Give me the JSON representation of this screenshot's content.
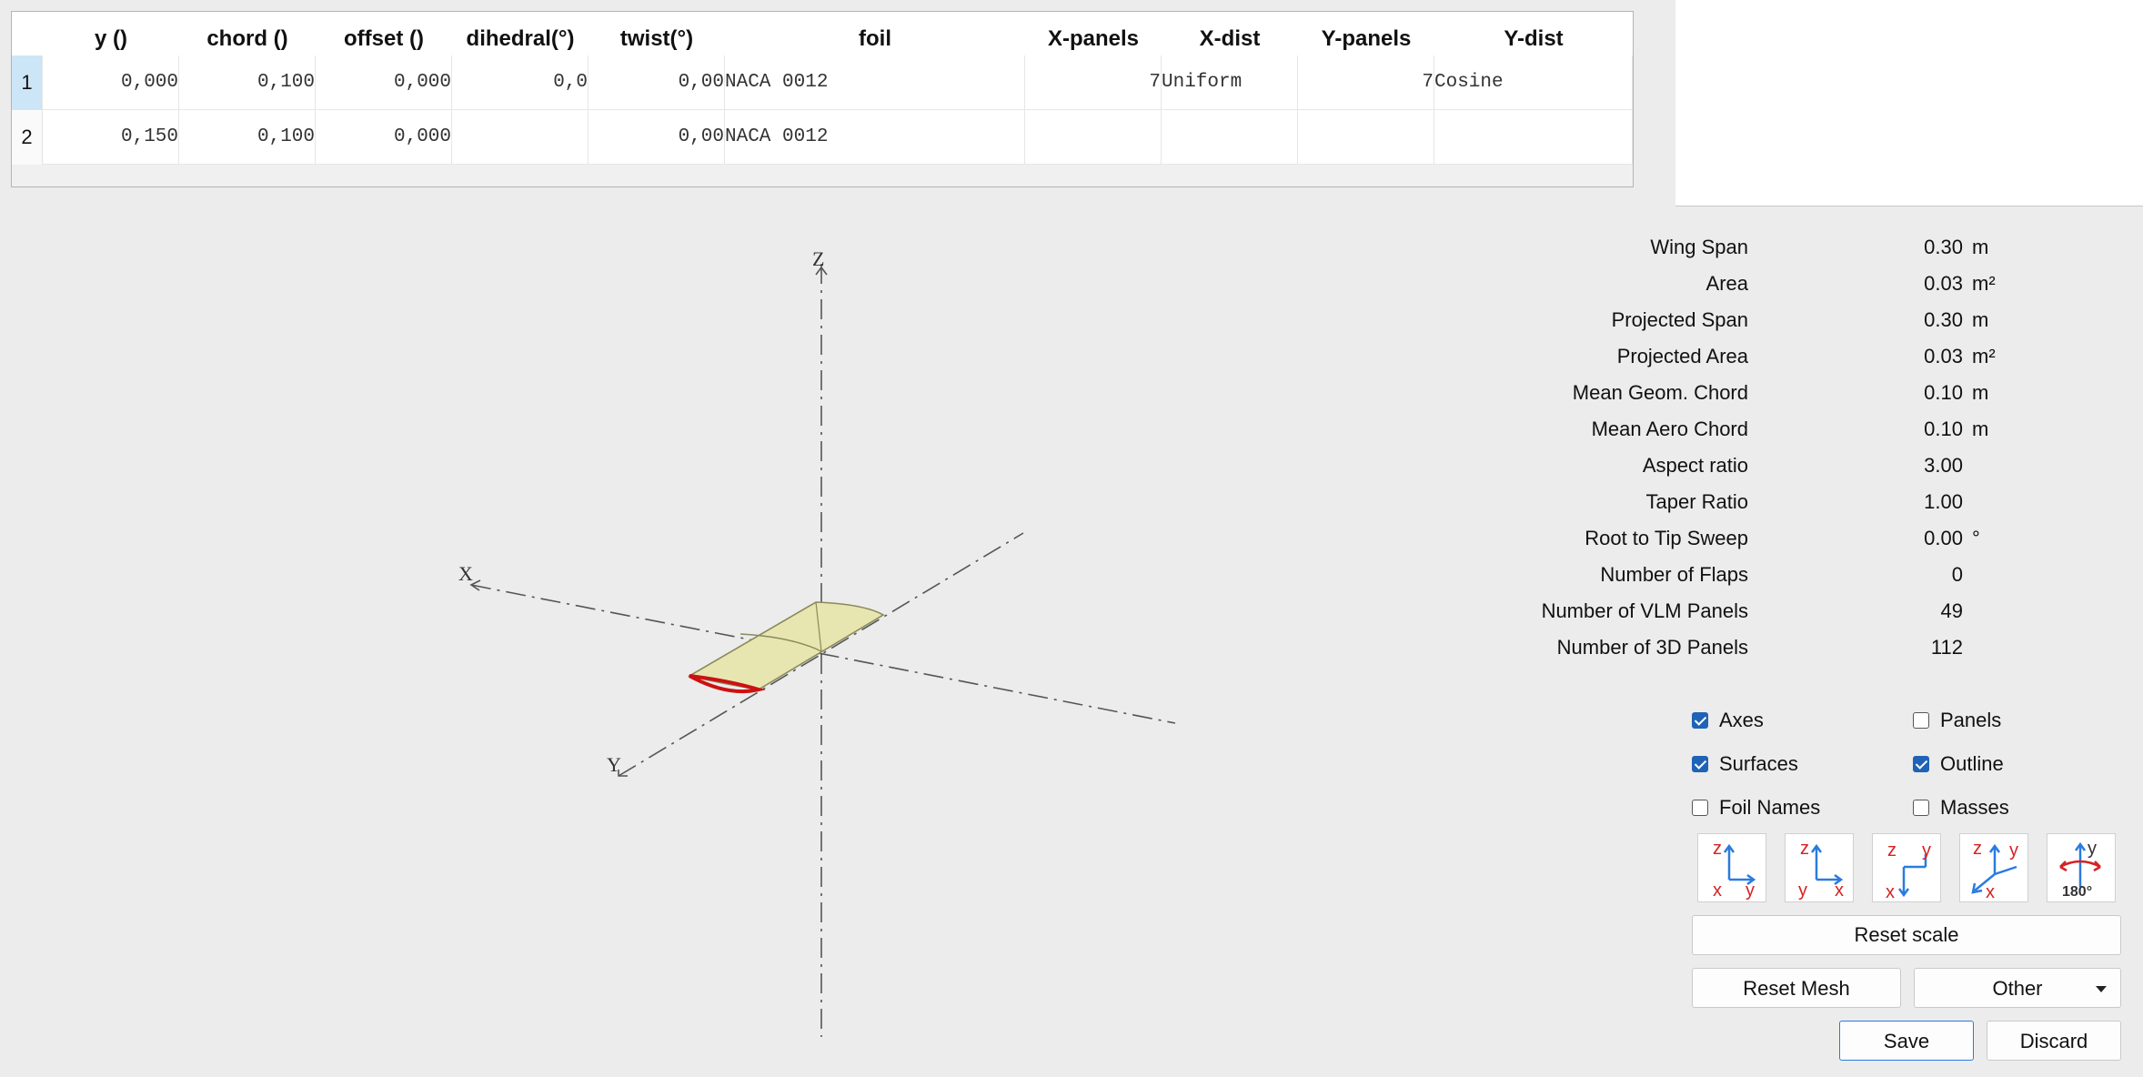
{
  "table": {
    "columns": [
      "y ()",
      "chord ()",
      "offset ()",
      "dihedral(°)",
      "twist(°)",
      "foil",
      "X-panels",
      "X-dist",
      "Y-panels",
      "Y-dist"
    ],
    "rows": [
      {
        "num": "1",
        "y": "0,000",
        "chord": "0,100",
        "offset": "0,000",
        "dihedral": "0,0",
        "twist": "0,00",
        "foil": "NACA 0012",
        "x_panels": "7",
        "x_dist": "Uniform",
        "y_panels": "7",
        "y_dist": "Cosine"
      },
      {
        "num": "2",
        "y": "0,150",
        "chord": "0,100",
        "offset": "0,000",
        "dihedral": "",
        "twist": "0,00",
        "foil": "NACA 0012",
        "x_panels": "",
        "x_dist": "",
        "y_panels": "",
        "y_dist": ""
      }
    ]
  },
  "viewport": {
    "axis_labels": {
      "x": "X",
      "y": "Y",
      "z": "Z"
    },
    "colors": {
      "axis": "#555555",
      "wing_fill": "#e8e6b0",
      "wing_edge": "#8a8a5c",
      "foil_outline": "#cc1111"
    }
  },
  "properties": [
    {
      "label": "Wing Span",
      "value": "0.30",
      "unit": "m"
    },
    {
      "label": "Area",
      "value": "0.03",
      "unit": "m²"
    },
    {
      "label": "Projected Span",
      "value": "0.30",
      "unit": "m"
    },
    {
      "label": "Projected Area",
      "value": "0.03",
      "unit": "m²"
    },
    {
      "label": "Mean Geom. Chord",
      "value": "0.10",
      "unit": "m"
    },
    {
      "label": "Mean Aero Chord",
      "value": "0.10",
      "unit": "m"
    },
    {
      "label": "Aspect ratio",
      "value": "3.00",
      "unit": ""
    },
    {
      "label": "Taper Ratio",
      "value": "1.00",
      "unit": ""
    },
    {
      "label": "Root to Tip Sweep",
      "value": "0.00",
      "unit": "°"
    },
    {
      "label": "Number of Flaps",
      "value": "0",
      "unit": ""
    },
    {
      "label": "Number of VLM Panels",
      "value": "49",
      "unit": ""
    },
    {
      "label": "Number of 3D Panels",
      "value": "112",
      "unit": ""
    }
  ],
  "display_options": [
    {
      "label": "Axes",
      "checked": true
    },
    {
      "label": "Panels",
      "checked": false
    },
    {
      "label": "Surfaces",
      "checked": true
    },
    {
      "label": "Outline",
      "checked": true
    },
    {
      "label": "Foil Names",
      "checked": false
    },
    {
      "label": "Masses",
      "checked": false
    }
  ],
  "view_buttons": {
    "colors": {
      "red": "#d62222",
      "blue": "#2a7be0"
    },
    "rotate_label": "180°",
    "axis_letters": {
      "x": "x",
      "y": "y",
      "z": "z"
    }
  },
  "buttons": {
    "reset_scale": "Reset scale",
    "reset_mesh": "Reset Mesh",
    "other": "Other",
    "save": "Save",
    "discard": "Discard"
  }
}
